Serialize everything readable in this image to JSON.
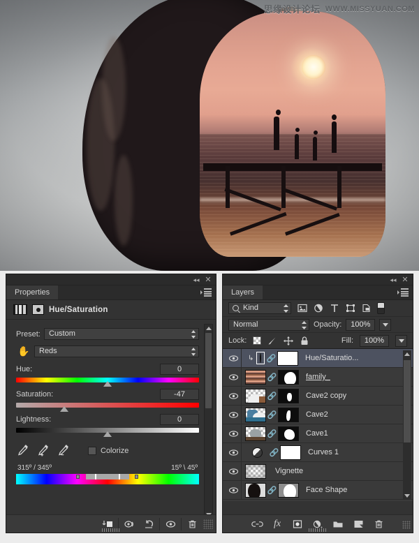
{
  "photo": {
    "watermark_cn": "思缘设计论坛",
    "watermark_url": "WWW.MISSYUAN.COM",
    "description": "Double exposure of woman profile silhouette with beach sunset and family on pier"
  },
  "properties_panel": {
    "tab_label": "Properties",
    "adjustment_title": "Hue/Saturation",
    "icons": {
      "adjustment": "histogram-icon",
      "mask": "mask-icon",
      "panel_menu": "panel-menu-icon",
      "collapse": "collapse-icon",
      "close": "close-icon",
      "targeted_adjust": "hand-scrub-icon"
    },
    "preset": {
      "label": "Preset:",
      "value": "Custom"
    },
    "channel": {
      "value": "Reds"
    },
    "sliders": [
      {
        "name": "Hue:",
        "value": "0",
        "num": 0,
        "thumb_pct": 50,
        "track": "hue"
      },
      {
        "name": "Saturation:",
        "value": "-47",
        "num": -47,
        "thumb_pct": 26.5,
        "track": "sat"
      },
      {
        "name": "Lightness:",
        "value": "0",
        "num": 0,
        "thumb_pct": 50,
        "track": "light"
      }
    ],
    "eyedroppers": [
      "eyedropper-icon",
      "eyedropper-add-icon",
      "eyedropper-subtract-icon"
    ],
    "colorize": {
      "label": "Colorize",
      "checked": false
    },
    "range": {
      "left_label": "315º / 345º",
      "right_label": "15º \\ 45º",
      "band_start_pct": 38,
      "band_end_pct": 62,
      "stop1_pct": 43,
      "stop2_pct": 56,
      "handle1_pct": 33,
      "handle2_pct": 65
    },
    "footer_buttons": [
      {
        "name": "clip-to-layer-button",
        "icon": "clip-to-layer-icon"
      },
      {
        "name": "toggle-previous-state-button",
        "icon": "previous-state-icon"
      },
      {
        "name": "reset-button",
        "icon": "reset-icon"
      },
      {
        "name": "toggle-visibility-button",
        "icon": "eye-icon"
      },
      {
        "name": "delete-button",
        "icon": "trash-icon"
      }
    ]
  },
  "layers_panel": {
    "tab_label": "Layers",
    "filter": {
      "kind_label": "Kind",
      "icons": [
        "filter-pixel-icon",
        "filter-adjustment-icon",
        "filter-type-icon",
        "filter-shape-icon",
        "filter-smart-object-icon"
      ],
      "toggle": "filter-enable-toggle"
    },
    "blend_mode": "Normal",
    "opacity_label": "Opacity:",
    "opacity_value": "100%",
    "lock_label": "Lock:",
    "lock_icons": [
      "lock-transparent-pixels-icon",
      "lock-image-pixels-icon",
      "lock-position-icon",
      "lock-all-icon"
    ],
    "fill_label": "Fill:",
    "fill_value": "100%",
    "layers": [
      {
        "name": "Hue/Saturatio...",
        "visible": true,
        "selected": true,
        "type": "adjustment",
        "clipped": true,
        "linked": true,
        "has_mask": true,
        "mask": "white",
        "underline": false
      },
      {
        "name": "family_",
        "visible": true,
        "selected": false,
        "type": "pixel",
        "thumb": "sunset",
        "linked": true,
        "has_mask": true,
        "mask": "head-profile",
        "underline": true
      },
      {
        "name": "Cave2 copy",
        "visible": true,
        "selected": false,
        "type": "pixel",
        "thumb": "cave-light",
        "linked": true,
        "has_mask": true,
        "mask": "small-shape",
        "underline": false
      },
      {
        "name": "Cave2",
        "visible": true,
        "selected": false,
        "type": "pixel",
        "thumb": "cave-blue",
        "linked": true,
        "has_mask": true,
        "mask": "flame-shape",
        "underline": false
      },
      {
        "name": "Cave1",
        "visible": true,
        "selected": false,
        "type": "pixel",
        "thumb": "cave-rock",
        "linked": true,
        "has_mask": true,
        "mask": "blob-shape",
        "underline": false
      },
      {
        "name": "Curves 1",
        "visible": true,
        "selected": false,
        "type": "adjustment",
        "clipped": false,
        "linked": true,
        "has_mask": true,
        "mask": "white",
        "underline": false
      },
      {
        "name": "Vignette",
        "visible": true,
        "selected": false,
        "type": "pixel",
        "thumb": "checker-vignette",
        "linked": false,
        "has_mask": false,
        "underline": false
      },
      {
        "name": "Face Shape",
        "visible": true,
        "selected": false,
        "type": "pixel",
        "thumb": "face-dark",
        "linked": true,
        "has_mask": true,
        "mask": "face-gray",
        "underline": false
      }
    ],
    "footer_buttons": [
      {
        "name": "link-layers-button",
        "icon": "link-icon"
      },
      {
        "name": "layer-style-button",
        "icon": "fx-icon"
      },
      {
        "name": "add-layer-mask-button",
        "icon": "mask-icon"
      },
      {
        "name": "new-adjustment-layer-button",
        "icon": "adjustment-icon"
      },
      {
        "name": "new-group-button",
        "icon": "folder-icon"
      },
      {
        "name": "new-layer-button",
        "icon": "new-layer-icon"
      },
      {
        "name": "delete-layer-button",
        "icon": "trash-icon"
      }
    ]
  },
  "colors": {
    "panel_bg": "#333333",
    "panel_dark": "#2b2b2b",
    "selection": "#4d5260",
    "text": "#dcdcdc",
    "field_bg": "#3d3d3d"
  }
}
